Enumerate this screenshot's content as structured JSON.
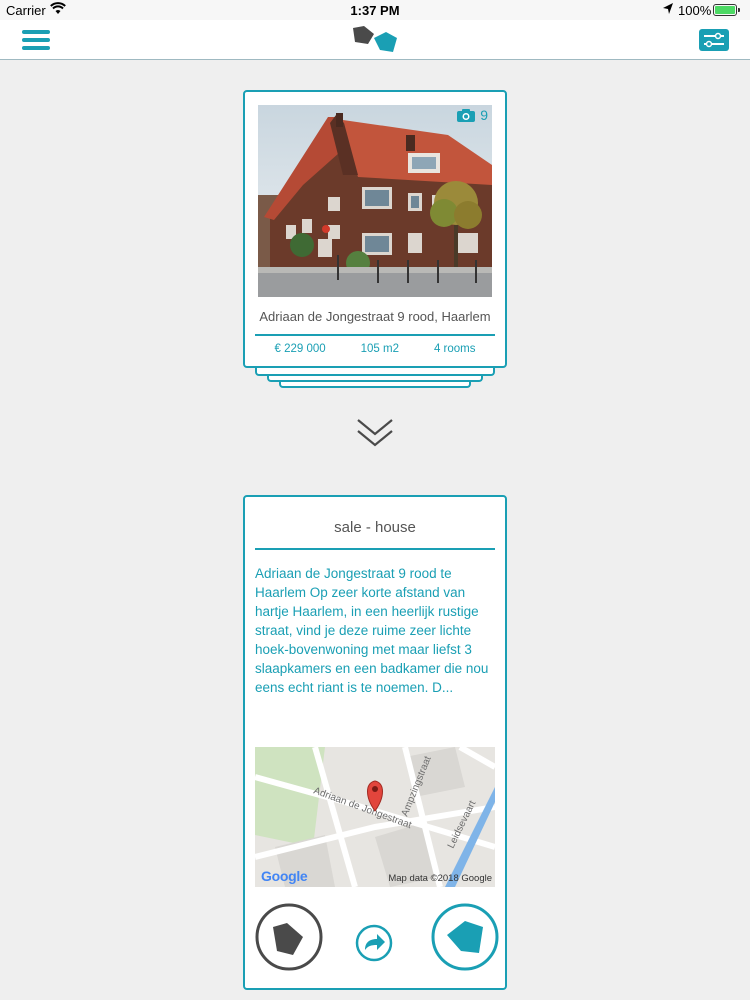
{
  "status_bar": {
    "carrier": "Carrier",
    "time": "1:37 PM",
    "battery": "100%"
  },
  "nav": {
    "menu_icon": "hamburger-menu-icon",
    "logo_icon": "app-logo-icon",
    "filter_icon": "filter-sliders-icon"
  },
  "listing": {
    "photo_count": "9",
    "address": "Adriaan de Jongestraat 9 rood, Haarlem",
    "price": "€ 229 000",
    "area": "105 m2",
    "rooms": "4 rooms"
  },
  "detail": {
    "title": "sale - house",
    "description": "Adriaan de Jongestraat 9 rood te Haarlem Op zeer korte afstand van hartje Haarlem, in een heerlijk rustige straat, vind je deze ruime zeer lichte hoek-bovenwoning met maar liefst 3 slaapkamers en een badkamer die nou eens echt riant is te noemen. D...",
    "map": {
      "street_label": "Adriaan de Jongestraat",
      "street_label_2": "Ampzingstraat",
      "street_label_3": "Leidsevaart",
      "google": "Google",
      "credit": "Map data ©2018 Google"
    }
  },
  "colors": {
    "accent": "#1a9fb4",
    "dark": "#4a4a4a"
  }
}
